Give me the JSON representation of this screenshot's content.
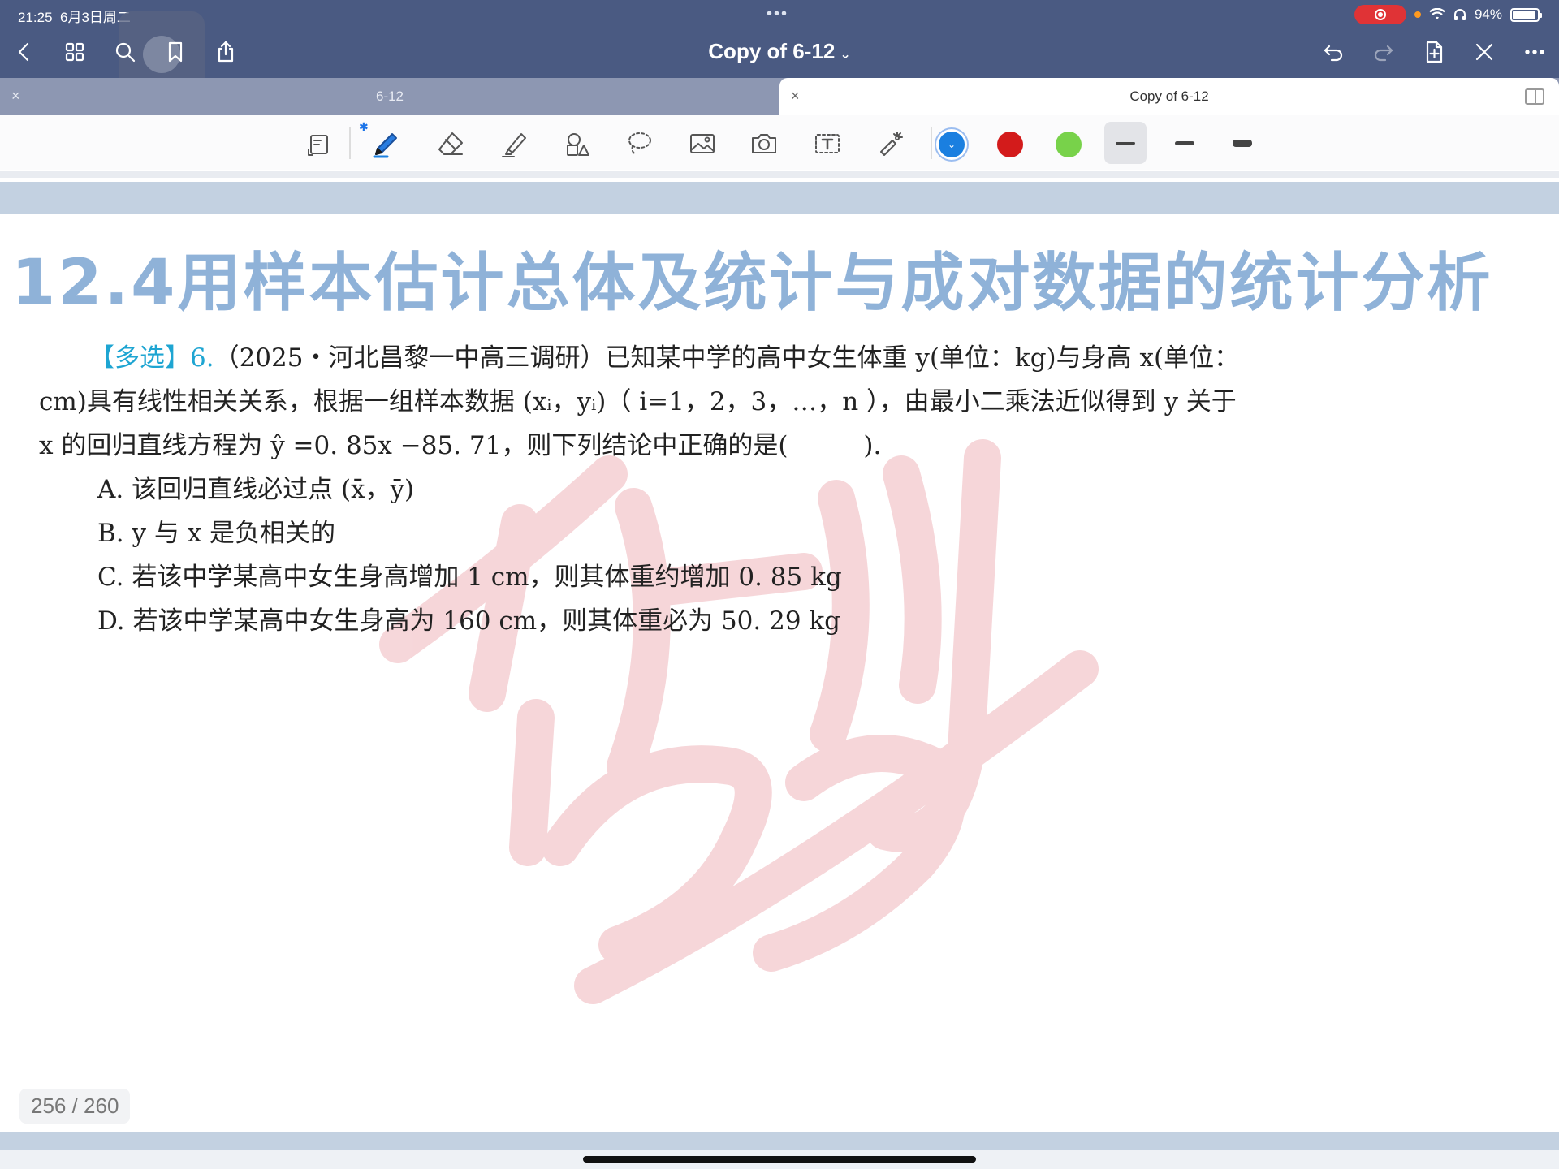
{
  "status_bar": {
    "time": "21:25",
    "date": "6月3日周二",
    "battery_percent_label": "94%",
    "battery_level": 0.94,
    "recording_color": "#e03336"
  },
  "nav": {
    "title": "Copy of 6-12",
    "title_caret": "⌄",
    "icons": [
      "back-icon",
      "grid-icon",
      "search-icon",
      "bookmark-icon",
      "share-icon",
      "undo-icon",
      "redo-icon",
      "add-page-icon",
      "close-icon",
      "more-icon"
    ]
  },
  "tabs": [
    {
      "label": "6-12",
      "active": false,
      "close": "×"
    },
    {
      "label": "Copy of 6-12",
      "active": true,
      "close": "×"
    }
  ],
  "toolbar": {
    "tools": [
      "read-mode-icon",
      "pen-icon",
      "eraser-icon",
      "highlighter-icon",
      "shapes-icon",
      "lasso-icon",
      "image-icon",
      "camera-icon",
      "text-box-icon",
      "laser-pointer-icon"
    ],
    "colors": [
      "#1a7fe0",
      "#d31b1b",
      "#78d24a"
    ],
    "selected_color_index": 0,
    "selected_color_mark": "⌄",
    "thickness_selected_index": 0
  },
  "page": {
    "chapter_title": "12.4用样本估计总体及统计与成对数据的统计分析",
    "question": {
      "tag": "【多选】",
      "number": "6.",
      "line1": "（2025・河北昌黎一中高三调研）已知某中学的高中女生体重 y(单位：kg)与身高 x(单位：",
      "line2": "cm)具有线性相关关系，根据一组样本数据 (xᵢ，yᵢ)（ i=1，2，3，…，n ），由最小二乘法近似得到 y 关于",
      "line3": "x 的回归直线方程为 ŷ =0. 85x −85. 71，则下列结论中正确的是(　　　).",
      "options": [
        "A.  该回归直线必过点 (x̄，ȳ)",
        "B.  y 与 x 是负相关的",
        "C.  若该中学某高中女生身高增加 1 cm，则其体重约增加 0. 85 kg",
        "D.  若该中学某高中女生身高为 160 cm，则其体重必为 50. 29 kg"
      ]
    },
    "page_counter": "256 / 260",
    "title_color": "#8fb2d8",
    "tag_color": "#1ea5d2"
  }
}
